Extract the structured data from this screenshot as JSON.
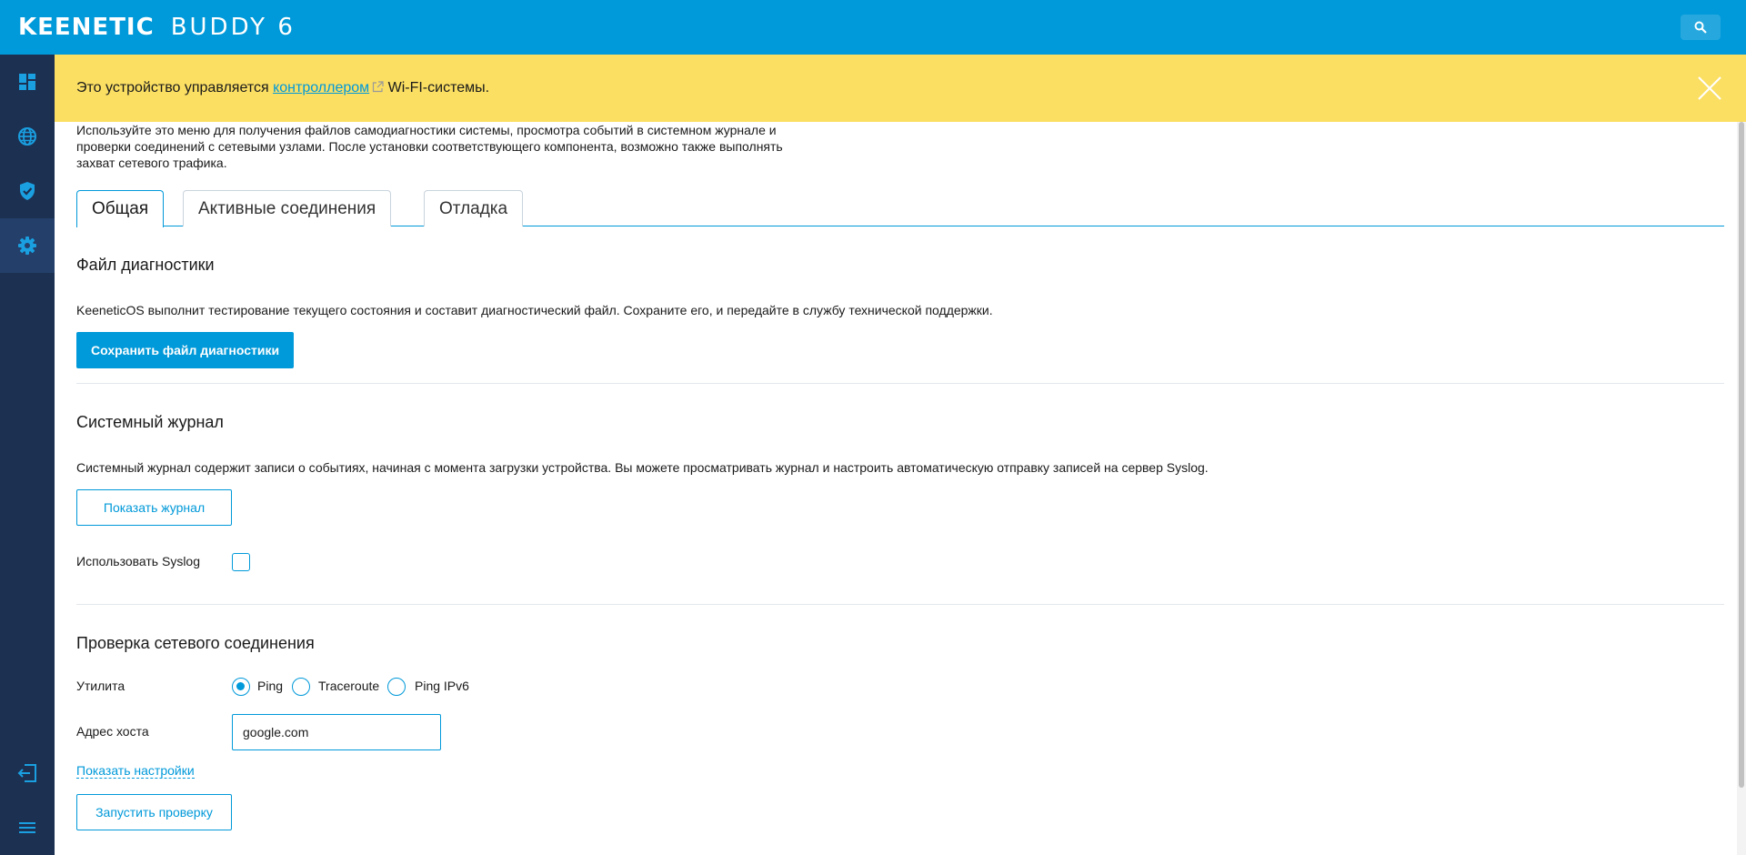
{
  "header": {
    "brand": "KEENETIC",
    "product": "BUDDY 6",
    "search_icon": "search-icon"
  },
  "sidebar": {
    "items": [
      {
        "name": "dashboard",
        "icon": "dashboard-icon",
        "active": false
      },
      {
        "name": "internet",
        "icon": "globe-icon",
        "active": false
      },
      {
        "name": "security",
        "icon": "shield-check-icon",
        "active": false
      },
      {
        "name": "settings",
        "icon": "gear-icon",
        "active": true
      }
    ],
    "bottom": [
      {
        "name": "logout",
        "icon": "logout-icon"
      },
      {
        "name": "menu",
        "icon": "menu-icon"
      }
    ]
  },
  "banner": {
    "text_before": "Это устройство управляется ",
    "link": "контроллером",
    "text_after": " Wi-FI-системы."
  },
  "intro": "Используйте это меню для получения файлов самодиагностики системы, просмотра событий в системном журнале и проверки соединений с сетевыми узлами. После установки соответствующего компонента, возможно также выполнять захват сетевого трафика.",
  "tabs": [
    {
      "label": "Общая",
      "active": true
    },
    {
      "label": "Активные соединения",
      "active": false
    },
    {
      "label": "Отладка",
      "active": false
    }
  ],
  "diagnostics": {
    "title": "Файл диагностики",
    "description": "KeeneticOS выполнит тестирование текущего состояния и составит диагностический файл. Сохраните его, и передайте в службу технической поддержки.",
    "button": "Сохранить файл диагностики"
  },
  "syslog": {
    "title": "Системный журнал",
    "description": "Системный журнал содержит записи о событиях, начиная с момента загрузки устройства. Вы можете просматривать журнал и настроить автоматическую отправку записей на сервер Syslog.",
    "button": "Показать журнал",
    "use_syslog_label": "Использовать Syslog",
    "use_syslog_checked": false
  },
  "network_check": {
    "title": "Проверка сетевого соединения",
    "utility_label": "Утилита",
    "utilities": [
      {
        "label": "Ping",
        "checked": true
      },
      {
        "label": "Traceroute",
        "checked": false
      },
      {
        "label": "Ping IPv6",
        "checked": false
      }
    ],
    "host_label": "Адрес хоста",
    "host_value": "google.com",
    "show_settings": "Показать настройки",
    "run_button": "Запустить проверку"
  },
  "colors": {
    "header": "#0099d9",
    "sidebar": "#1c3052",
    "banner": "#fbdf63",
    "accent": "#0099d9"
  }
}
